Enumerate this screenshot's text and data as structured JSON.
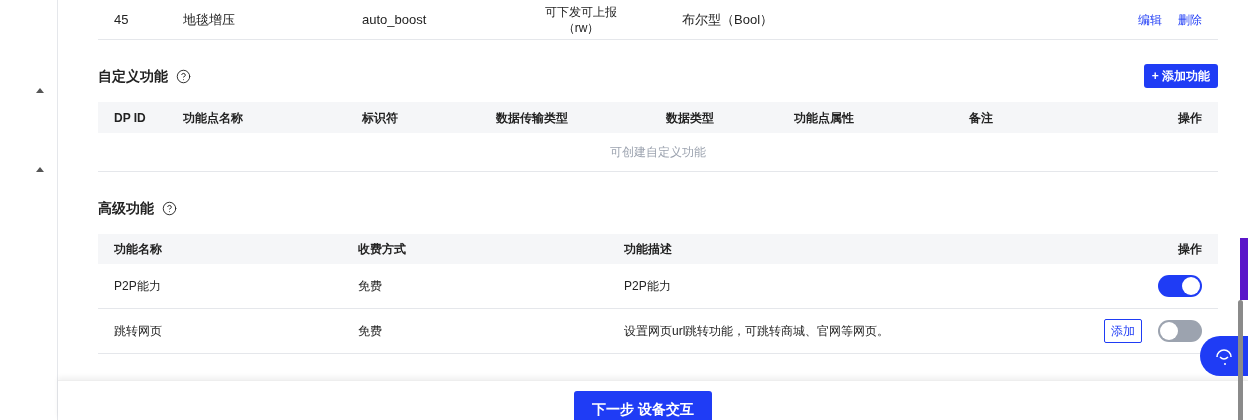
{
  "dp_table": {
    "rows": [
      {
        "id": "45",
        "name": "地毯增压",
        "identifier": "auto_boost",
        "transfer": [
          "可下发可上报",
          "（rw）"
        ],
        "data_type": "布尔型（Bool）",
        "actions": [
          "编辑",
          "删除"
        ]
      }
    ]
  },
  "custom_section": {
    "title": "自定义功能",
    "add_button": "+ 添加功能",
    "columns": [
      "DP ID",
      "功能点名称",
      "标识符",
      "数据传输类型",
      "数据类型",
      "功能点属性",
      "备注",
      "操作"
    ],
    "empty_text": "可创建自定义功能"
  },
  "advanced_section": {
    "title": "高级功能",
    "columns": [
      "功能名称",
      "收费方式",
      "功能描述",
      "操作"
    ],
    "rows": [
      {
        "name": "P2P能力",
        "fee": "免费",
        "description": "P2P能力",
        "on": true
      },
      {
        "name": "跳转网页",
        "fee": "免费",
        "description": "设置网页url跳转功能，可跳转商城、官网等网页。",
        "add_button": "添加",
        "on": false
      }
    ]
  },
  "footer": {
    "next_button": "下一步 设备交互"
  }
}
